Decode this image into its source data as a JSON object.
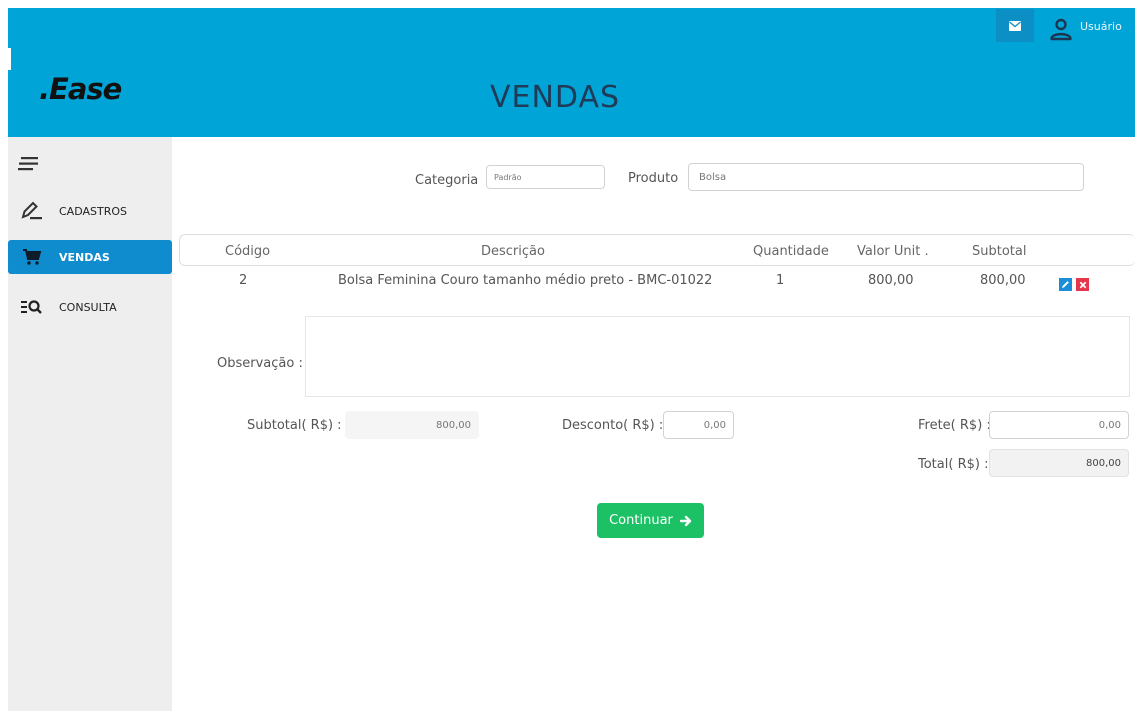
{
  "header": {
    "logo": ".Ease",
    "title": "VENDAS",
    "user_label": "Usuário",
    "bg_color": "#00a4d6"
  },
  "sidebar": {
    "items": [
      {
        "label": "CADASTROS",
        "icon": "pen-icon"
      },
      {
        "label": "VENDAS",
        "icon": "cart-icon",
        "active": true
      },
      {
        "label": "CONSULTA",
        "icon": "list-search-icon"
      }
    ]
  },
  "filters": {
    "categoria_label": "Categoria",
    "categoria_value": "Padrão",
    "produto_label": "Produto",
    "produto_value": "Bolsa"
  },
  "table": {
    "columns": [
      "Código",
      "Descrição",
      "Quantidade",
      "Valor Unit .",
      "Subtotal"
    ],
    "rows": [
      {
        "codigo": "2",
        "descricao": "Bolsa Feminina Couro tamanho médio preto - BMC-01022",
        "quantidade": "1",
        "valor_unit": "800,00",
        "subtotal": "800,00"
      }
    ]
  },
  "observacao": {
    "label": "Observação :",
    "value": ""
  },
  "totals": {
    "subtotal_label": "Subtotal( R$) :",
    "subtotal_value": "800,00",
    "desconto_label": "Desconto( R$) :",
    "desconto_value": "0,00",
    "frete_label": "Frete( R$) :",
    "frete_value": "0,00",
    "total_label": "Total( R$) :",
    "total_value": "800,00"
  },
  "actions": {
    "continue_label": "Continuar",
    "continue_color": "#1cc165"
  }
}
